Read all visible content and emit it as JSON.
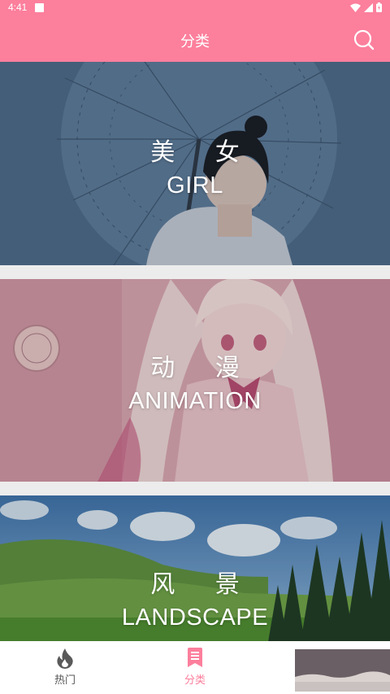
{
  "status_bar": {
    "time": "4:41"
  },
  "app_bar": {
    "title": "分类"
  },
  "categories": [
    {
      "name_cn": "美 女",
      "name_en": "GIRL"
    },
    {
      "name_cn": "动 漫",
      "name_en": "ANIMATION"
    },
    {
      "name_cn": "风 景",
      "name_en": "LANDSCAPE"
    }
  ],
  "bottom_nav": {
    "items": [
      {
        "label": "热门",
        "icon": "flame-icon"
      },
      {
        "label": "分类",
        "icon": "bookmark-list-icon"
      }
    ]
  },
  "colors": {
    "accent": "#fc7f9c",
    "nav_inactive": "#555555"
  }
}
